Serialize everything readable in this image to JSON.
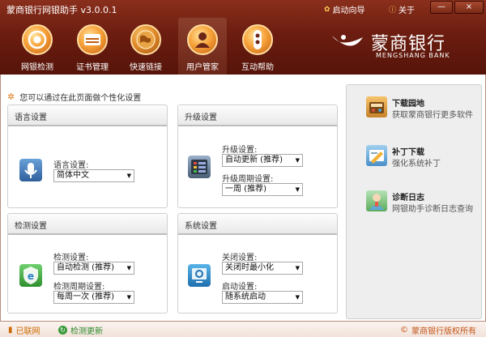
{
  "app": {
    "title": "蒙商银行网银助手 v3.0.0.1"
  },
  "topbar": {
    "guide_label": "启动向导",
    "about_label": "关于",
    "minimize": "—",
    "close": "×"
  },
  "nav": [
    {
      "label": "网银检测",
      "icon": "target-icon"
    },
    {
      "label": "证书管理",
      "icon": "certificate-icon"
    },
    {
      "label": "快速链接",
      "icon": "globe-icon"
    },
    {
      "label": "用户管家",
      "icon": "user-icon",
      "active": true
    },
    {
      "label": "互动帮助",
      "icon": "help-icon"
    }
  ],
  "brand": {
    "name_cn": "蒙商银行",
    "name_en": "MENGSHANG BANK"
  },
  "hint": "您可以通过在此页面做个性化设置",
  "panels": {
    "language": {
      "title": "语言设置",
      "label": "语言设置:",
      "value": "简体中文"
    },
    "upgrade": {
      "title": "升级设置",
      "label1": "升级设置:",
      "value1": "自动更新 (推荐)",
      "label2": "升级周期设置:",
      "value2": "一周 (推荐)"
    },
    "detect": {
      "title": "检测设置",
      "label1": "检测设置:",
      "value1": "自动检测 (推荐)",
      "label2": "检测周期设置:",
      "value2": "每周一次 (推荐)"
    },
    "system": {
      "title": "系统设置",
      "label1": "关闭设置:",
      "value1": "关闭时最小化",
      "label2": "启动设置:",
      "value2": "随系统启动"
    }
  },
  "right": [
    {
      "title": "下载园地",
      "sub": "获取蒙商银行更多软件",
      "icon": "download-icon"
    },
    {
      "title": "补丁下载",
      "sub": "强化系统补丁",
      "icon": "patch-icon"
    },
    {
      "title": "诊断日志",
      "sub": "网银助手诊断日志查询",
      "icon": "diagnostic-icon"
    }
  ],
  "status": {
    "network": "已联网",
    "update": "检测更新",
    "copyright": "蒙商银行版权所有"
  },
  "colors": {
    "header": "#6c1d10",
    "accent": "#f7a23a",
    "status_text": "#c2571a"
  }
}
